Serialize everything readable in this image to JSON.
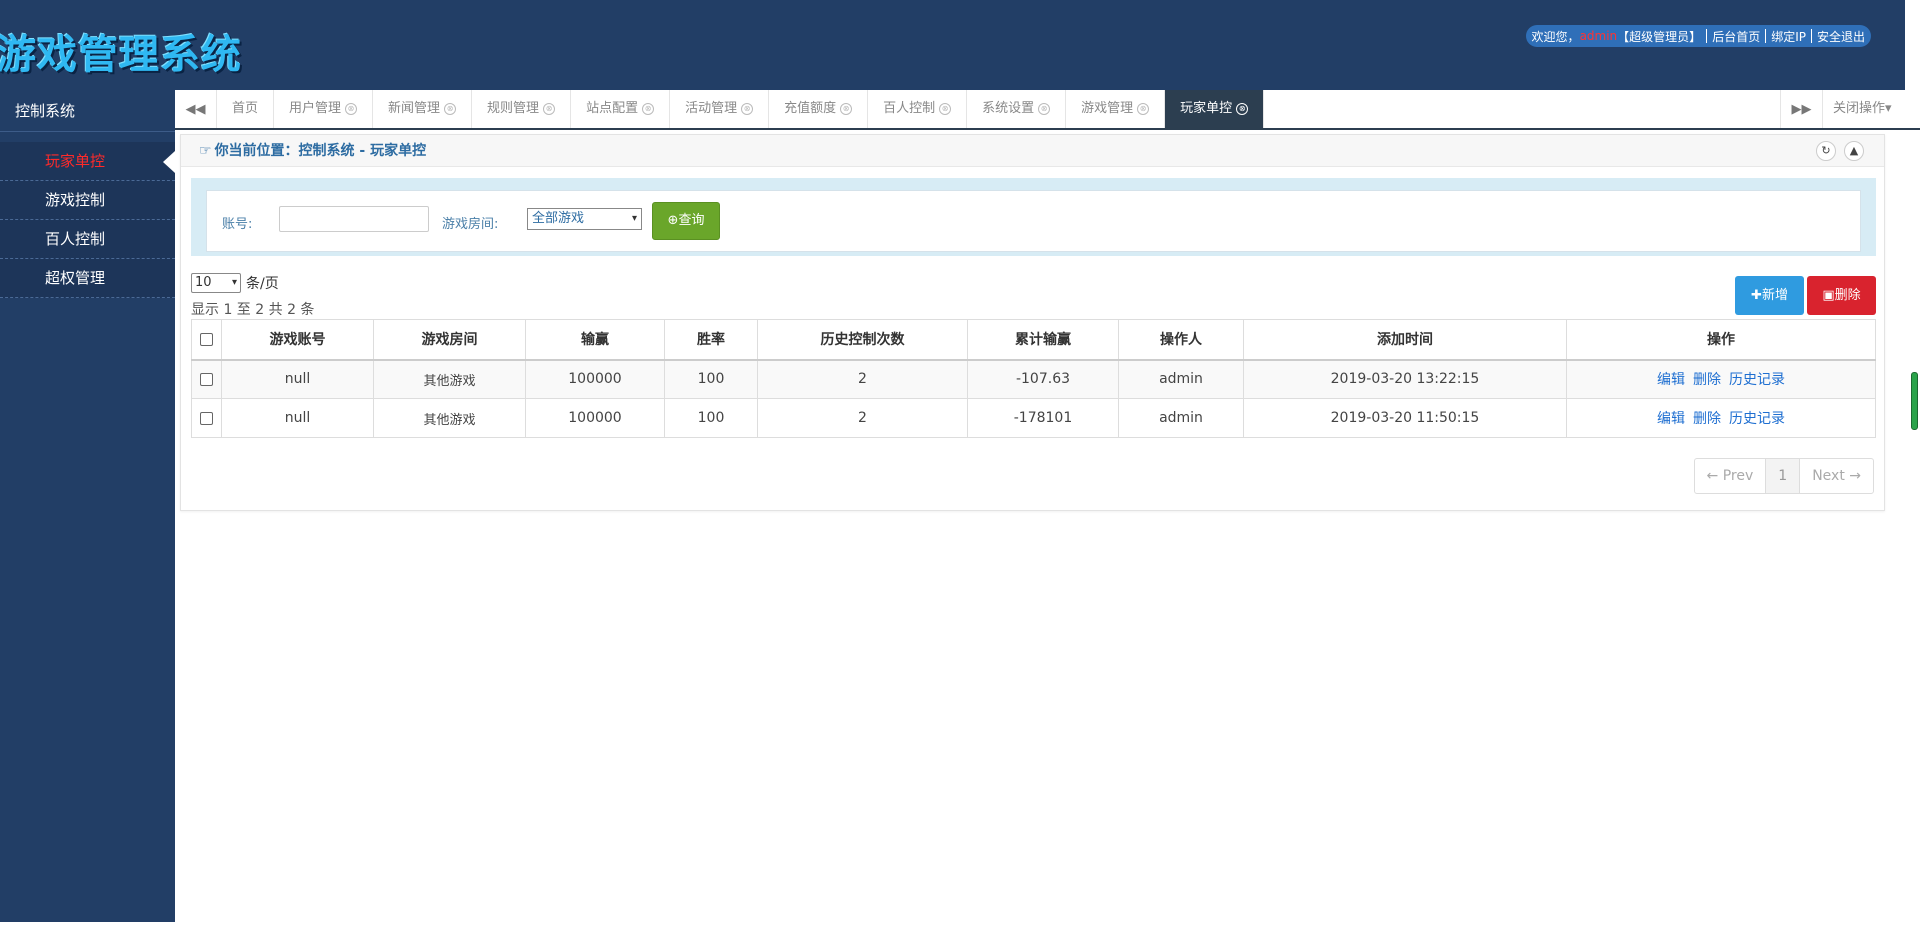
{
  "header": {
    "logo_text": "游戏管理系统",
    "welcome": "欢迎您，",
    "username": "admin",
    "role": "【超级管理员】",
    "links": [
      "后台首页",
      "绑定IP",
      "安全退出"
    ]
  },
  "sidebar": {
    "title": "控制系统",
    "items": [
      {
        "label": "玩家单控"
      },
      {
        "label": "游戏控制"
      },
      {
        "label": "百人控制"
      },
      {
        "label": "超权管理"
      }
    ]
  },
  "tabs": {
    "items": [
      "首页",
      "用户管理",
      "新闻管理",
      "规则管理",
      "站点配置",
      "活动管理",
      "充值额度",
      "百人控制",
      "系统设置",
      "游戏管理",
      "玩家单控"
    ],
    "close_icon": "⊗",
    "close_ops": "关闭操作▾"
  },
  "breadcrumb": {
    "text": "你当前位置：控制系统 - 玩家单控"
  },
  "search": {
    "account_label": "账号:",
    "account_value": "",
    "room_label": "游戏房间:",
    "room_selected": "全部游戏",
    "query_button": "查询"
  },
  "listing": {
    "page_size": "10",
    "page_size_suffix": "条/页",
    "info": "显示 1 至 2 共 2 条",
    "add_button": "新增",
    "delete_button": "删除"
  },
  "table": {
    "columns": [
      "游戏账号",
      "游戏房间",
      "输赢",
      "胜率",
      "历史控制次数",
      "累计输赢",
      "操作人",
      "添加时间",
      "操作"
    ],
    "rows": [
      {
        "account": "null",
        "room": "其他游戏",
        "winloss": "100000",
        "rate": "100",
        "history": "2",
        "total": "-107.63",
        "operator": "admin",
        "time": "2019-03-20 13:22:15"
      },
      {
        "account": "null",
        "room": "其他游戏",
        "winloss": "100000",
        "rate": "100",
        "history": "2",
        "total": "-178101",
        "operator": "admin",
        "time": "2019-03-20 11:50:15"
      }
    ],
    "ops": [
      "编辑",
      "删除",
      "历史记录"
    ]
  },
  "pagination": {
    "prev": "← Prev",
    "current": "1",
    "next": "Next →"
  }
}
